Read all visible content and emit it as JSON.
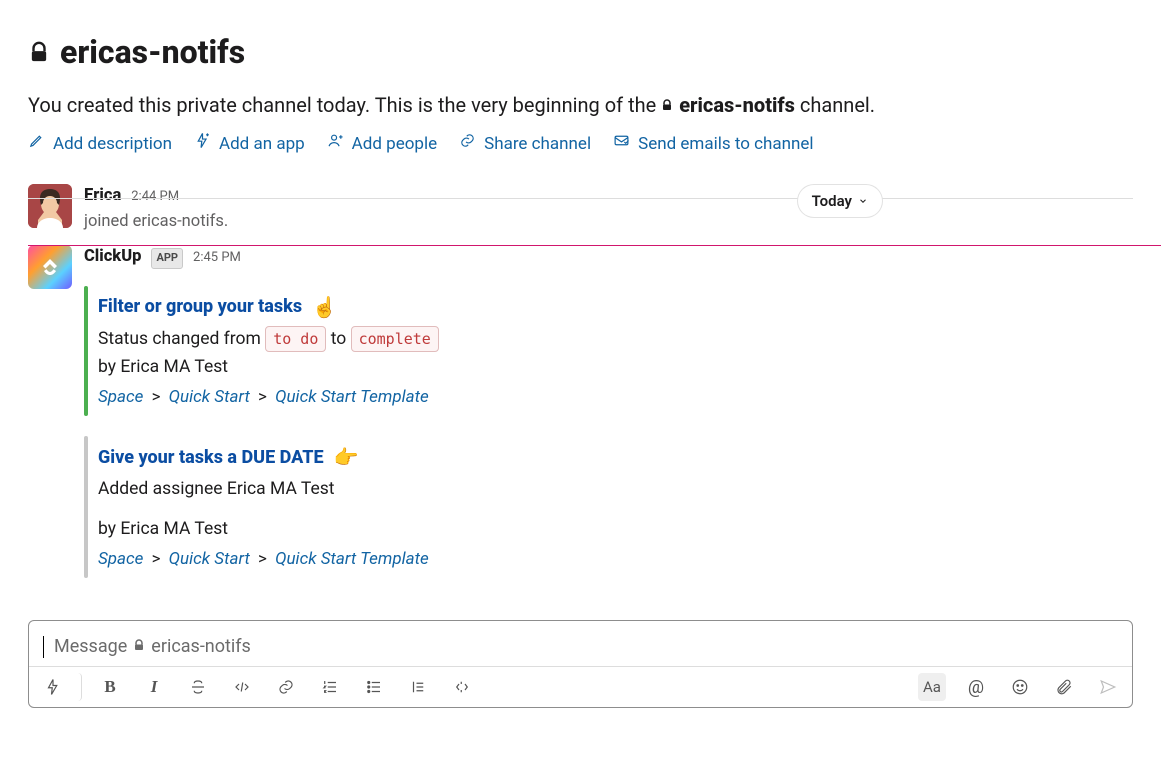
{
  "header": {
    "channel_name": "ericas-notifs",
    "intro_prefix": "You created this private channel today. This is the very beginning of the ",
    "intro_channel": "ericas-notifs",
    "intro_suffix": " channel."
  },
  "actions": {
    "add_description": "Add description",
    "add_app": "Add an app",
    "add_people": "Add people",
    "share_channel": "Share channel",
    "send_emails": "Send emails to channel"
  },
  "divider": {
    "label": "Today"
  },
  "messages": {
    "join": {
      "sender": "Erica",
      "time": "2:44 PM",
      "text": "joined ericas-notifs."
    },
    "clickup": {
      "sender": "ClickUp",
      "badge": "APP",
      "time": "2:45 PM",
      "attachments": [
        {
          "title": "Filter or group your tasks",
          "emoji": "☝️",
          "status_line_prefix": "Status changed from ",
          "status_from": "to do",
          "status_mid": " to ",
          "status_to": "complete",
          "byline": "by Erica MA Test",
          "crumbs": [
            "Space",
            "Quick Start",
            "Quick Start Template"
          ]
        },
        {
          "title": "Give your tasks a DUE DATE",
          "emoji": "👉",
          "line": "Added assignee Erica MA Test",
          "byline": "by Erica MA Test",
          "crumbs": [
            "Space",
            "Quick Start",
            "Quick Start Template"
          ]
        }
      ]
    }
  },
  "composer": {
    "placeholder_prefix": "Message ",
    "placeholder_channel": "ericas-notifs",
    "aa": "Aa"
  }
}
